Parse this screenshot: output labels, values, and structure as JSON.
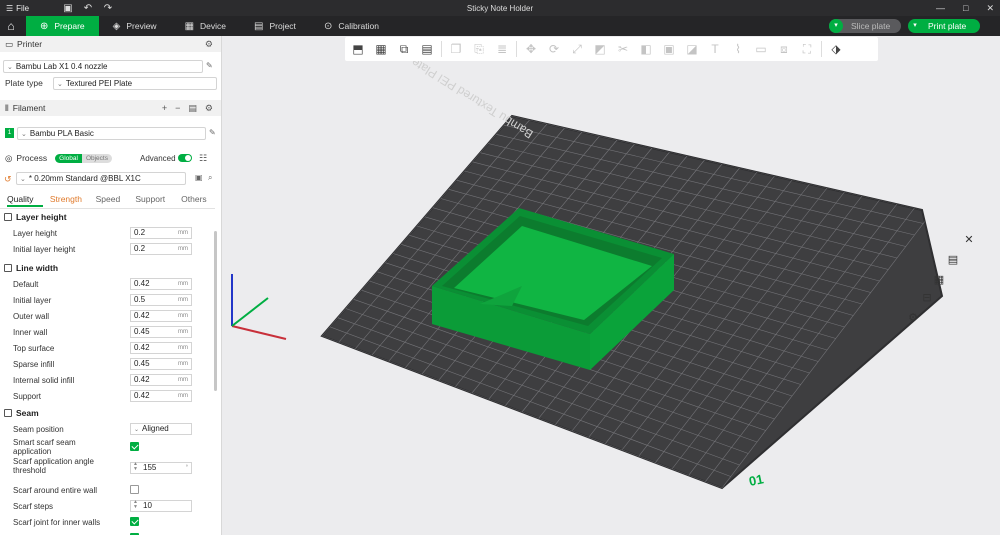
{
  "window": {
    "file_label": "File",
    "title": "Sticky Note Holder",
    "controls": [
      "—",
      "□",
      "✕"
    ]
  },
  "tabs": [
    {
      "label": "Prepare",
      "icon": "prepare-icon"
    },
    {
      "label": "Preview",
      "icon": "preview-icon"
    },
    {
      "label": "Device",
      "icon": "device-icon"
    },
    {
      "label": "Project",
      "icon": "project-icon"
    },
    {
      "label": "Calibration",
      "icon": "calibration-icon"
    }
  ],
  "actions": {
    "slice": "Slice plate",
    "print": "Print plate"
  },
  "printer": {
    "header": "Printer",
    "name": "Bambu Lab X1 0.4 nozzle",
    "plate_label": "Plate type",
    "plate_value": "Textured PEI Plate"
  },
  "filament": {
    "header": "Filament",
    "slot": "1",
    "name": "Bambu PLA Basic"
  },
  "process": {
    "header": "Process",
    "scope_on": "Global",
    "scope_off": "Objects",
    "advanced_label": "Advanced",
    "preset": "* 0.20mm Standard @BBL X1C",
    "tabs": [
      "Quality",
      "Strength",
      "Speed",
      "Support",
      "Others"
    ],
    "layer_height_title": "Layer height",
    "layer_height": [
      {
        "label": "Layer height",
        "value": "0.2",
        "unit": "mm"
      },
      {
        "label": "Initial layer height",
        "value": "0.2",
        "unit": "mm"
      }
    ],
    "line_width_title": "Line width",
    "line_width": [
      {
        "label": "Default",
        "value": "0.42",
        "unit": "mm"
      },
      {
        "label": "Initial layer",
        "value": "0.5",
        "unit": "mm"
      },
      {
        "label": "Outer wall",
        "value": "0.42",
        "unit": "mm"
      },
      {
        "label": "Inner wall",
        "value": "0.45",
        "unit": "mm"
      },
      {
        "label": "Top surface",
        "value": "0.42",
        "unit": "mm"
      },
      {
        "label": "Sparse infill",
        "value": "0.45",
        "unit": "mm"
      },
      {
        "label": "Internal solid infill",
        "value": "0.42",
        "unit": "mm"
      },
      {
        "label": "Support",
        "value": "0.42",
        "unit": "mm"
      }
    ],
    "seam_title": "Seam",
    "seam_position_label": "Seam position",
    "seam_position_value": "Aligned",
    "smart_scarf_label": "Smart scarf seam application",
    "scarf_angle_label": "Scarf application angle threshold",
    "scarf_angle_value": "155",
    "scarf_angle_unit": "°",
    "scarf_around_label": "Scarf around entire wall",
    "scarf_steps_label": "Scarf steps",
    "scarf_steps_value": "10",
    "scarf_inner_label": "Scarf joint for inner walls"
  },
  "viewport": {
    "plate_text": "Bambu Textured PEI Plate",
    "plate_number": "01",
    "model_color": "#0ba33a",
    "plate_color": "#3e3e40",
    "grid_color": "#737377"
  }
}
